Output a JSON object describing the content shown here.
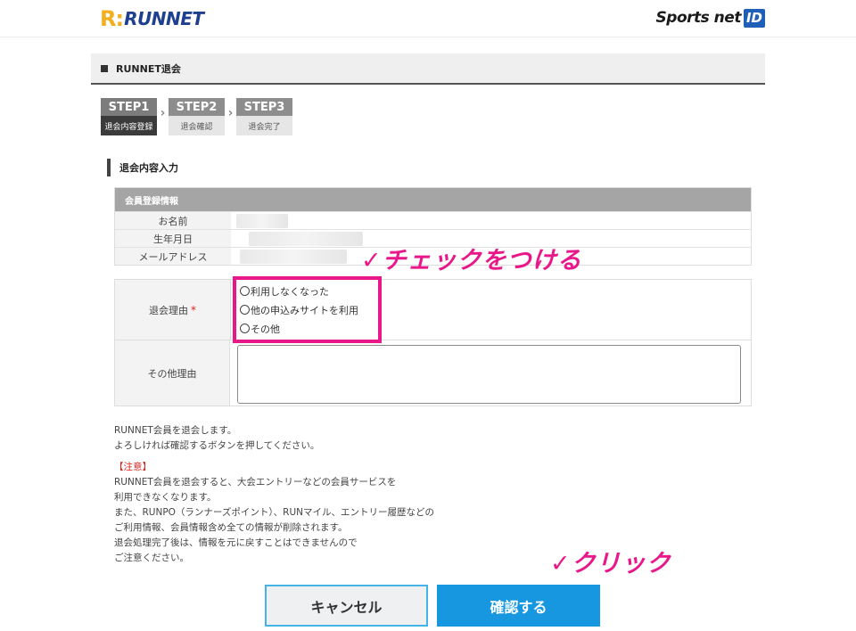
{
  "header": {
    "runnet_logo_mark": "R:",
    "runnet_logo_text": "RUNNET",
    "sportsnet_logo_text": "Sports net",
    "sportsnet_logo_id": "ID"
  },
  "page_title": "RUNNET退会",
  "steps": [
    {
      "label": "STEP1",
      "caption": "退会内容登録",
      "active": true
    },
    {
      "label": "STEP2",
      "caption": "退会確認",
      "active": false
    },
    {
      "label": "STEP3",
      "caption": "退会完了",
      "active": false
    }
  ],
  "section_heading": "退会内容入力",
  "member_info": {
    "header": "会員登録情報",
    "rows": [
      {
        "label": "お名前"
      },
      {
        "label": "生年月日"
      },
      {
        "label": "メールアドレス"
      }
    ]
  },
  "reason": {
    "label": "退会理由",
    "required_mark": "*",
    "options": [
      "利用しなくなった",
      "他の申込みサイトを利用",
      "その他"
    ],
    "other_label": "その他理由",
    "other_value": ""
  },
  "annotations": {
    "check": "✓チェックをつける",
    "click": "✓クリック"
  },
  "notes": {
    "line1": "RUNNET会員を退会します。",
    "line2": "よろしければ確認するボタンを押してください。",
    "warning_title": "【注意】",
    "w1": "RUNNET会員を退会すると、大会エントリーなどの会員サービスを",
    "w2": "利用できなくなります。",
    "w3": "また、RUNPO（ランナーズポイント）、RUNマイル、エントリー履歴などの",
    "w4": "ご利用情報、会員情報含め全ての情報が削除されます。",
    "w5": "退会処理完了後は、情報を元に戻すことはできませんので",
    "w6": "ご注意ください。"
  },
  "buttons": {
    "cancel": "キャンセル",
    "confirm": "確認する"
  },
  "colors": {
    "accent": "#1697df",
    "highlight": "#e8178a",
    "required": "#d9261c"
  }
}
